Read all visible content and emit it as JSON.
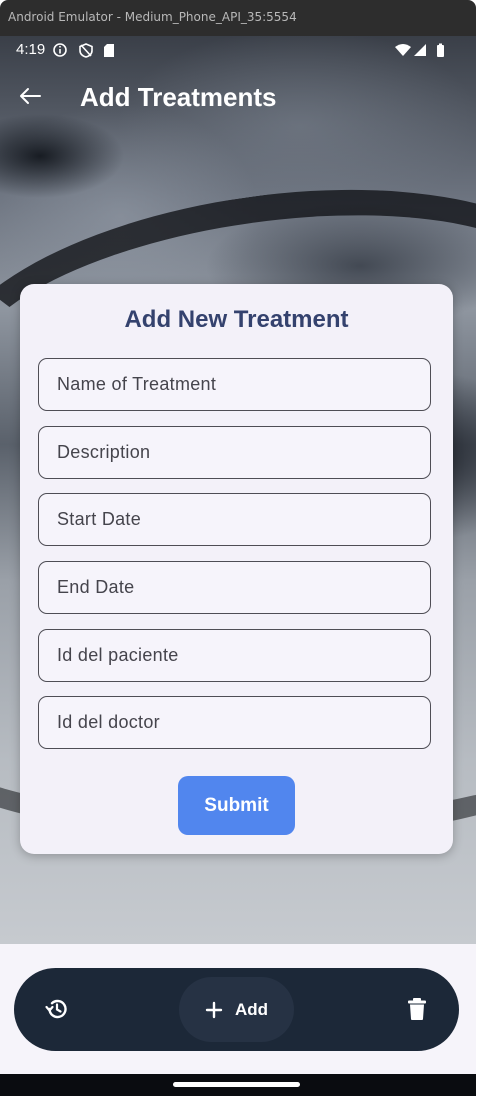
{
  "window": {
    "title": "Android Emulator - Medium_Phone_API_35:5554"
  },
  "status_bar": {
    "time": "4:19"
  },
  "app_bar": {
    "title": "Add Treatments"
  },
  "form": {
    "title": "Add New Treatment",
    "fields": [
      {
        "placeholder": "Name of Treatment",
        "value": ""
      },
      {
        "placeholder": "Description",
        "value": ""
      },
      {
        "placeholder": "Start Date",
        "value": ""
      },
      {
        "placeholder": "End Date",
        "value": ""
      },
      {
        "placeholder": "Id del paciente",
        "value": ""
      },
      {
        "placeholder": "Id del doctor",
        "value": ""
      }
    ],
    "submit_label": "Submit"
  },
  "bottom_nav": {
    "add_label": "Add",
    "icons": {
      "history": "history-icon",
      "add": "plus-icon",
      "delete": "trash-icon"
    }
  },
  "colors": {
    "card_title": "#34426e",
    "submit_button": "#5186ee",
    "nav_bar": "#1c2838",
    "card_background": "#f3f1f9"
  }
}
